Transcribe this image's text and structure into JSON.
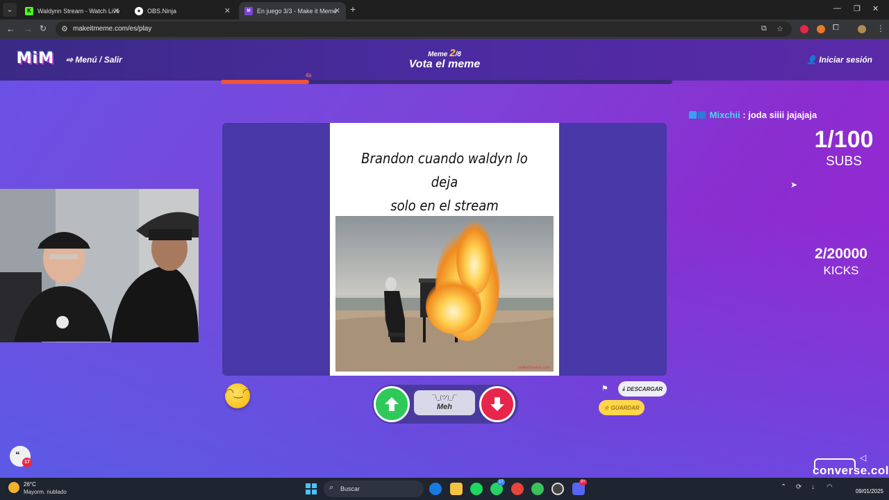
{
  "browser": {
    "tabs": [
      {
        "title": "Waldynn Stream - Watch Live o",
        "active": false,
        "favicon": "kick-icon",
        "color": "#53fc18"
      },
      {
        "title": "OBS.Ninja",
        "active": false,
        "favicon": "obs-ninja-icon",
        "color": "#ffffff"
      },
      {
        "title": "En juego 3/3 - Make it Meme",
        "active": true,
        "favicon": "mim-icon",
        "color": "#7b44d8"
      }
    ],
    "url": "makeitmeme.com/es/play"
  },
  "header": {
    "logo": "MiM",
    "menu_exit": "Menú / Salir",
    "meme_label": "Meme",
    "meme_current": "2",
    "meme_total": "/8",
    "vote_title": "Vota el meme",
    "login": "Iniciar sesión"
  },
  "timer": {
    "label": "4s",
    "progress": 0.195,
    "fill_color": "#f0533b"
  },
  "meme": {
    "caption_line1": "Brandon cuando waldyn lo deja",
    "caption_line2": "solo en el stream",
    "watermark": "makeitmeme.com"
  },
  "voting": {
    "meh_face": "¯\\_(ツ)_/¯",
    "meh_label": "Meh",
    "up_color": "#2fc95a",
    "down_color": "#e8254a"
  },
  "actions": {
    "download_label": "DESCARGAR",
    "save_label": "GUARDAR"
  },
  "stream_overlay": {
    "chat_user": "Mixchii",
    "chat_message": " : joda siiii jajajaja",
    "subs_count": "1/100",
    "subs_label": "SUBS",
    "kicks_count": "2/20000",
    "kicks_label": "KICKS",
    "brand": "converse.col",
    "chat_badge_count": "17"
  },
  "taskbar": {
    "weather_temp": "26°C",
    "weather_desc": "Mayorm. nublado",
    "search_label": "Buscar",
    "whatsapp_badge": "17",
    "discord_badge": "9+",
    "date": "09/01/2025"
  }
}
